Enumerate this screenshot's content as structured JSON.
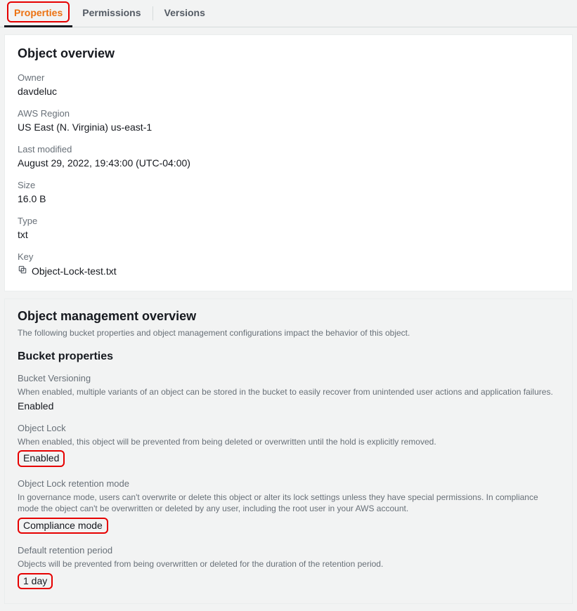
{
  "tabs": {
    "properties": "Properties",
    "permissions": "Permissions",
    "versions": "Versions"
  },
  "overview": {
    "title": "Object overview",
    "owner_label": "Owner",
    "owner_value": "davdeluc",
    "region_label": "AWS Region",
    "region_value": "US East (N. Virginia) us-east-1",
    "last_modified_label": "Last modified",
    "last_modified_value": "August 29, 2022, 19:43:00 (UTC-04:00)",
    "size_label": "Size",
    "size_value": "16.0 B",
    "type_label": "Type",
    "type_value": "txt",
    "key_label": "Key",
    "key_value": "Object-Lock-test.txt"
  },
  "mgmt": {
    "title": "Object management overview",
    "subtitle": "The following bucket properties and object management configurations impact the behavior of this object.",
    "bucket_props_title": "Bucket properties",
    "versioning": {
      "label": "Bucket Versioning",
      "desc": "When enabled, multiple variants of an object can be stored in the bucket to easily recover from unintended user actions and application failures.",
      "value": "Enabled"
    },
    "object_lock": {
      "label": "Object Lock",
      "desc": "When enabled, this object will be prevented from being deleted or overwritten until the hold is explicitly removed.",
      "value": "Enabled"
    },
    "retention_mode": {
      "label": "Object Lock retention mode",
      "desc": "In governance mode, users can't overwrite or delete this object or alter its lock settings unless they have special permissions. In compliance mode the object can't be overwritten or deleted by any user, including the root user in your AWS account.",
      "value": "Compliance mode"
    },
    "retention_period": {
      "label": "Default retention period",
      "desc": "Objects will be prevented from being overwritten or deleted for the duration of the retention period.",
      "value": "1 day"
    }
  }
}
